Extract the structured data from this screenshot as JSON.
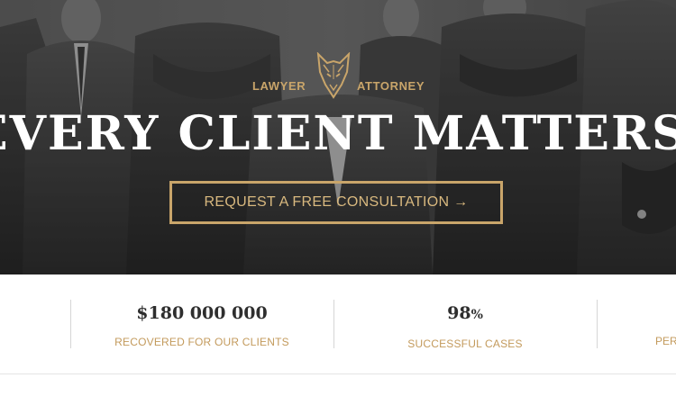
{
  "hero": {
    "brand_left": "LAWYER",
    "brand_right": "ATTORNEY",
    "logo_icon": "fox-head-icon",
    "headline": "EVERY CLIENT MATTERS.",
    "cta_label": "REQUEST A FREE CONSULTATION →"
  },
  "stats": [
    {
      "value": "$180 000 000",
      "label": "RECOVERED FOR OUR CLIENTS"
    },
    {
      "value": "98",
      "value_suffix": "%",
      "label": "SUCCESSFUL CASES"
    },
    {
      "label_partial": "PER"
    }
  ],
  "colors": {
    "accent_gold": "#c9a56a",
    "headline": "#ffffff",
    "stat_value": "#2e2e2e",
    "stat_label": "#c39a5c"
  }
}
